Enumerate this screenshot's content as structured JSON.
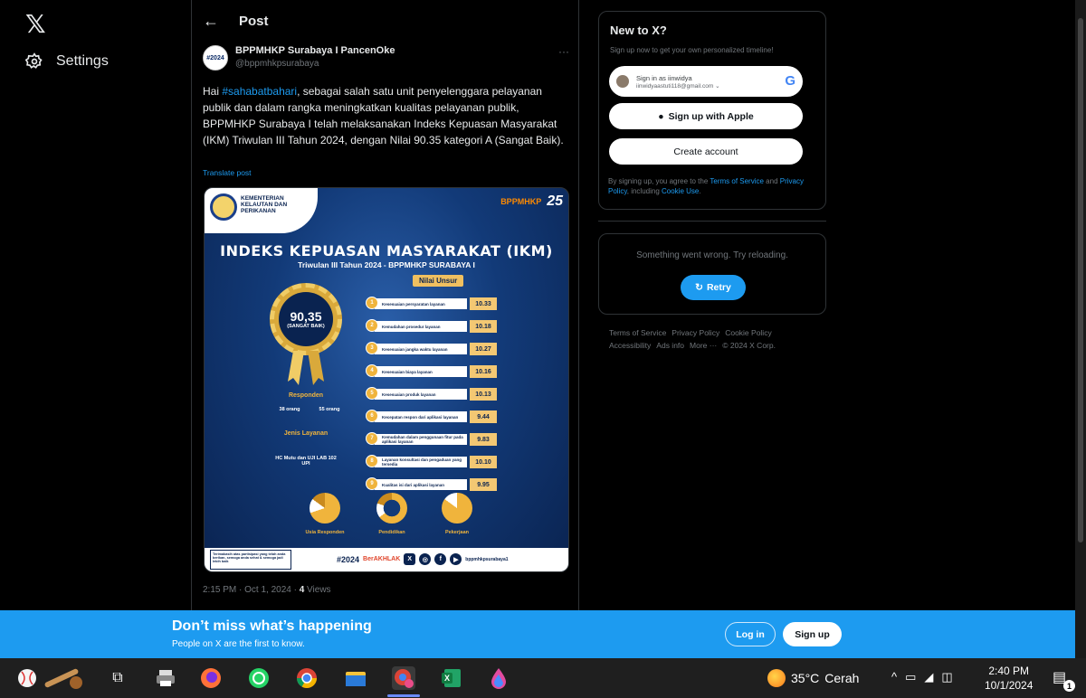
{
  "nav": {
    "settings_label": "Settings"
  },
  "post": {
    "header_title": "Post",
    "author_name": "BPPMHKP Surabaya I PancenOke",
    "author_handle": "@bppmhkpsurabaya",
    "avatar_text": "#2024",
    "text_prefix": "Hai ",
    "hashtag": "#sahabatbahari",
    "text_body": ", sebagai salah satu unit penyelenggara pelayanan publik dan dalam rangka meningkatkan kualitas pelayanan publik, BPPMHKP Surabaya I telah melaksanakan Indeks Kepuasan Masyarakat (IKM) Triwulan III Tahun 2024, dengan Nilai 90.35 kategori A (Sangat Baik).",
    "translate_label": "Translate post",
    "meta_time": "2:15 PM · Oct 1, 2024 · ",
    "meta_views_count": "4",
    "meta_views_label": " Views"
  },
  "infographic": {
    "ministry": "KEMENTERIAN KELAUTAN DAN PERIKANAN",
    "brand": "BPPMHKP",
    "anniversary": "25",
    "title": "INDEKS KEPUASAN MASYARAKAT (IKM)",
    "subtitle": "Triwulan III Tahun 2024 - BPPMHKP SURABAYA I",
    "score": "90,35",
    "category": "(SANGAT BAIK)",
    "nilai_unsur_label": "Nilai Unsur",
    "unsur": [
      {
        "n": "1",
        "label": "Kesesuaian persyaratan layanan",
        "value": "10.33"
      },
      {
        "n": "2",
        "label": "Kemudahan prosedur layanan",
        "value": "10.18"
      },
      {
        "n": "3",
        "label": "Kesesuaian jangka waktu layanan",
        "value": "10.27"
      },
      {
        "n": "4",
        "label": "Kesesuaian biaya layanan",
        "value": "10.16"
      },
      {
        "n": "5",
        "label": "Kesesuaian produk layanan",
        "value": "10.13"
      },
      {
        "n": "6",
        "label": "Kecepatan respon dari aplikasi layanan",
        "value": "9.44"
      },
      {
        "n": "7",
        "label": "Kemudahan dalam penggunaan fitur pada aplikasi layanan",
        "value": "9.83"
      },
      {
        "n": "8",
        "label": "Layanan konsultasi dan pengaduan yang tersedia",
        "value": "10.10"
      },
      {
        "n": "9",
        "label": "Kualitas isi dari aplikasi layanan",
        "value": "9.95"
      }
    ],
    "responden_label": "Responden",
    "responden_male": "38 orang",
    "responden_female": "55 orang",
    "jenis_layanan_label": "Jenis Layanan",
    "jenis_layanan_value": "HC Mutu dan UJI LAB 102 UPI",
    "pie_labels": [
      "Usia Responden",
      "Pendidikan",
      "Pekerjaan"
    ],
    "bottom_quote": "Terimakasih atas partisipasi yang telah anda berikan, semoga anda sehat & semoga jadi lebih baik",
    "bottom_2024": "#2024",
    "bottom_berakhlak": "BerAKHLAK",
    "bottom_handle": "bppmhkpsurabaya1"
  },
  "signup": {
    "title": "New to X?",
    "subtitle": "Sign up now to get your own personalized timeline!",
    "google_line1": "Sign in as iinwidya",
    "google_line2": "iinwidyaastuti118@gmail.com",
    "apple_label": "Sign up with Apple",
    "create_label": "Create account",
    "terms_prefix": "By signing up, you agree to the ",
    "terms_link": "Terms of Service",
    "terms_and": " and ",
    "privacy_link": "Privacy Policy",
    "terms_including": ", including ",
    "cookie_link": "Cookie Use",
    "terms_end": "."
  },
  "error_card": {
    "message": "Something went wrong. Try reloading.",
    "retry_label": "Retry"
  },
  "footer": {
    "links": [
      "Terms of Service",
      "Privacy Policy",
      "Cookie Policy",
      "Accessibility",
      "Ads info",
      "More ···",
      "© 2024 X Corp."
    ]
  },
  "banner": {
    "title": "Don’t miss what’s happening",
    "subtitle": "People on X are the first to know.",
    "login_label": "Log in",
    "signup_label": "Sign up"
  },
  "taskbar": {
    "weather_temp": "35°C",
    "weather_desc": "Cerah",
    "time": "2:40 PM",
    "date": "10/1/2024",
    "notification_count": "1"
  },
  "colors": {
    "accent": "#1d9bf0",
    "background": "#000000",
    "muted": "#71767b",
    "border": "#2f3336"
  }
}
